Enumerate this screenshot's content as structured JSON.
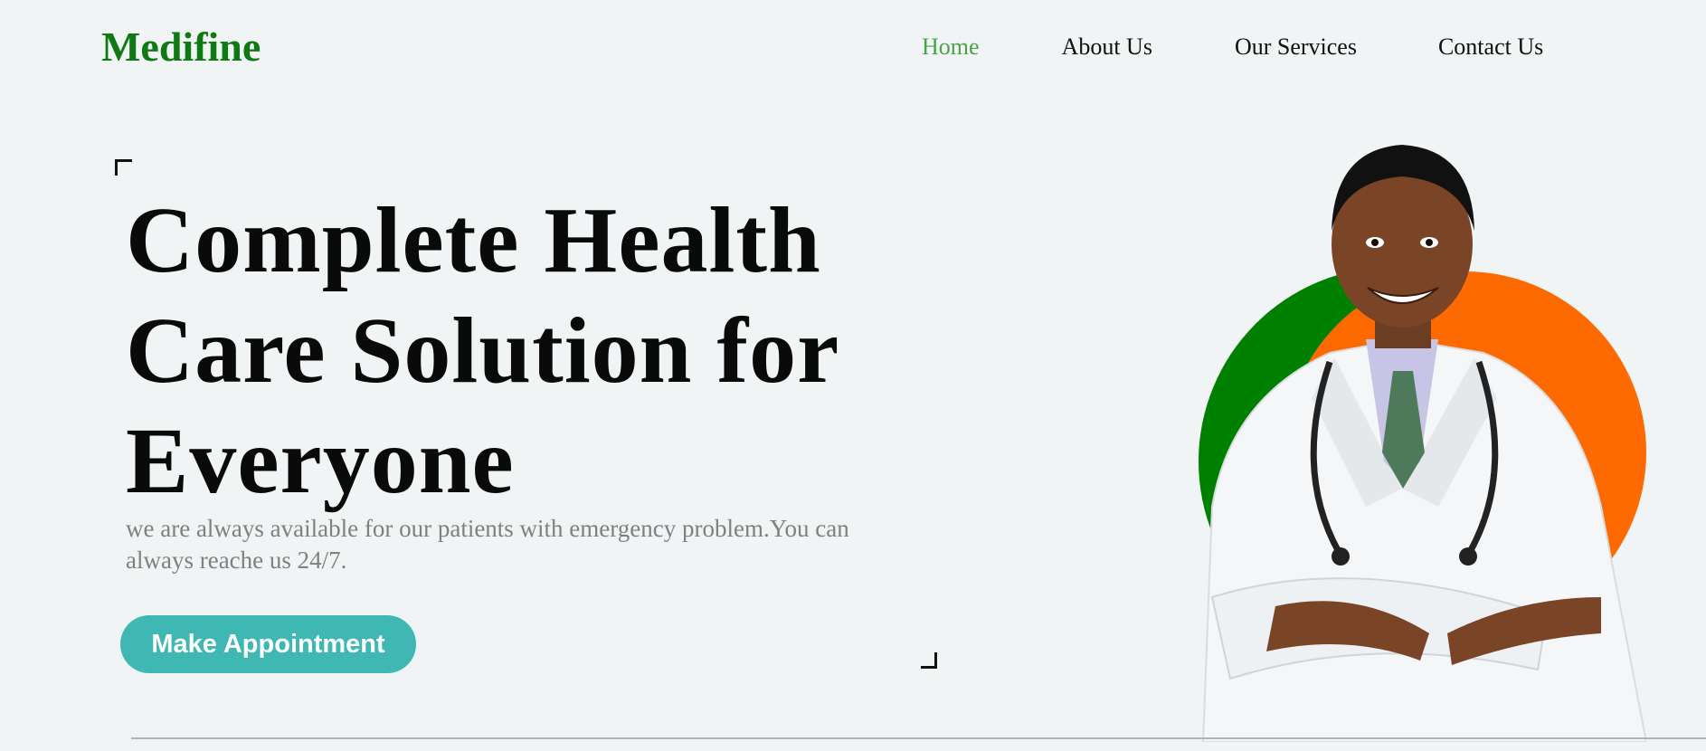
{
  "brand": {
    "logo": "Medifine",
    "color": "#0f7a14"
  },
  "nav": {
    "items": [
      {
        "label": "Home",
        "active": true
      },
      {
        "label": "About Us",
        "active": false
      },
      {
        "label": "Our Services",
        "active": false
      },
      {
        "label": "Contact Us",
        "active": false
      }
    ],
    "active_color": "#4aa34a"
  },
  "hero": {
    "title": "Complete Health Care Solution for Everyone",
    "subtitle": "we are always available for our patients with emergency problem.You can always reache us 24/7.",
    "cta_label": "Make Appointment",
    "cta_color": "#3fb7b3"
  },
  "illustration": {
    "subject": "smiling doctor in white coat with stethoscope",
    "circle_colors": [
      "#008000",
      "#ff6a00"
    ]
  }
}
